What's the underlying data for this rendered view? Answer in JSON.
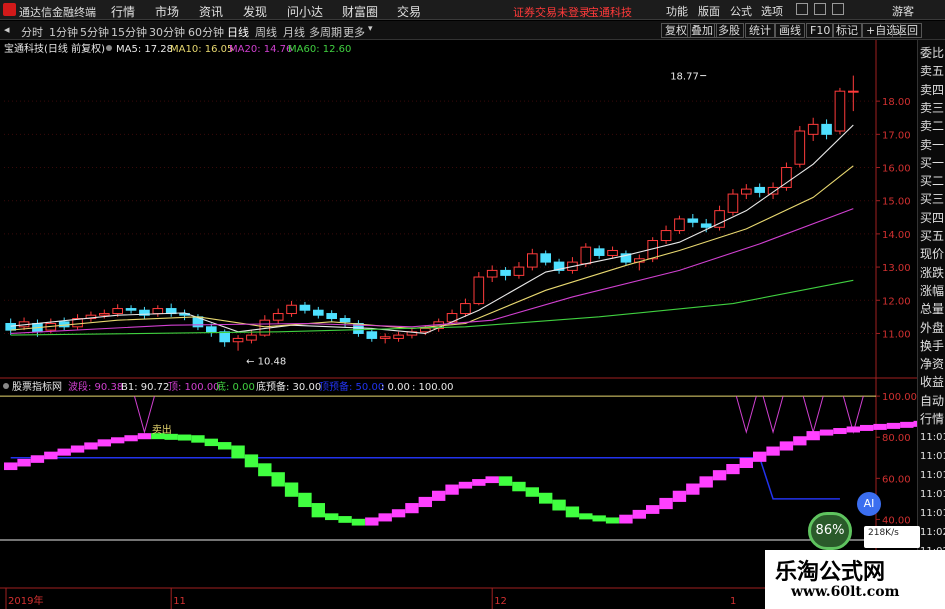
{
  "app": {
    "title": "通达信金融终端",
    "menu": [
      "行情",
      "市场",
      "资讯",
      "发现",
      "问小达",
      "财富圈",
      "交易"
    ],
    "warning": "证券交易未登录",
    "stock_name_top": "宝通科技",
    "right_buttons": [
      "功能",
      "版面",
      "公式",
      "选项"
    ],
    "user_label": "游客"
  },
  "periods": {
    "items": [
      "分时",
      "1分钟",
      "5分钟",
      "15分钟",
      "30分钟",
      "60分钟",
      "日线",
      "周线",
      "月线",
      "多周期",
      "更多"
    ],
    "active": "日线",
    "tools": [
      "复权",
      "叠加",
      "多股",
      "统计",
      "画线",
      "F10",
      "标记",
      "+自选",
      "返回"
    ]
  },
  "main_legend": {
    "title": "宝通科技(日线 前复权)",
    "ma": [
      {
        "label": "MA5: 17.28",
        "color": "#e8e8e8"
      },
      {
        "label": "MA10: 16.05",
        "color": "#e8d870"
      },
      {
        "label": "MA20: 14.76",
        "color": "#d040d0"
      },
      {
        "label": "MA60: 12.60",
        "color": "#40d040"
      }
    ]
  },
  "indicator_legend": {
    "title": "股票指标网",
    "items": [
      {
        "label": "波段: 90.38",
        "color": "#d040d0"
      },
      {
        "label": "B1: 90.72",
        "color": "#e8e8e8"
      },
      {
        "label": "顶: 100.00",
        "color": "#d040d0"
      },
      {
        "label": "底: 0.00",
        "color": "#40d040"
      },
      {
        "label": "底预备: 30.00",
        "color": "#e8e8e8"
      },
      {
        "label": "顶预备: 50.00",
        "color": "#2233ee"
      },
      {
        "label": ": 0.00",
        "color": "#e8e8e8"
      },
      {
        "label": ": 100.00",
        "color": "#e8e8e8"
      }
    ],
    "sell_label": "卖出"
  },
  "right_panel": {
    "items": [
      "委比",
      "卖五",
      "卖四",
      "卖三",
      "卖二",
      "卖一",
      "买一",
      "买二",
      "买三",
      "买四",
      "买五",
      "现价",
      "涨跌",
      "涨幅",
      "总量",
      "外盘",
      "换手",
      "净资",
      "收益",
      "自动",
      "行情"
    ],
    "times": [
      "11:01",
      "11:01",
      "11:01",
      "11:01",
      "11:01",
      "11:02",
      "11:02",
      "11:02",
      "11:02"
    ]
  },
  "badges": {
    "ai": "AI",
    "speed": "86%",
    "net": "218K/s"
  },
  "watermark": {
    "title": "乐淘公式网",
    "url": "www.60lt.com"
  },
  "chart_data": [
    {
      "type": "candlestick",
      "title": "宝通科技(日线 前复权)",
      "yticks": [
        11.0,
        12.0,
        13.0,
        14.0,
        15.0,
        16.0,
        17.0,
        18.0
      ],
      "ylim": [
        10.2,
        19.3
      ],
      "annotations": [
        {
          "text": "18.77",
          "index": 52,
          "value": 18.77,
          "kind": "high"
        },
        {
          "text": "10.48",
          "index": 17,
          "value": 10.48,
          "kind": "low"
        }
      ],
      "candles": [
        {
          "o": 11.3,
          "c": 11.1,
          "h": 11.45,
          "l": 10.95
        },
        {
          "o": 11.2,
          "c": 11.35,
          "h": 11.48,
          "l": 11.1
        },
        {
          "o": 11.3,
          "c": 11.05,
          "h": 11.42,
          "l": 10.9
        },
        {
          "o": 11.1,
          "c": 11.3,
          "h": 11.45,
          "l": 11.0
        },
        {
          "o": 11.35,
          "c": 11.2,
          "h": 11.48,
          "l": 11.1
        },
        {
          "o": 11.2,
          "c": 11.45,
          "h": 11.58,
          "l": 11.12
        },
        {
          "o": 11.45,
          "c": 11.55,
          "h": 11.66,
          "l": 11.35
        },
        {
          "o": 11.55,
          "c": 11.6,
          "h": 11.72,
          "l": 11.45
        },
        {
          "o": 11.6,
          "c": 11.75,
          "h": 11.88,
          "l": 11.5
        },
        {
          "o": 11.75,
          "c": 11.7,
          "h": 11.85,
          "l": 11.6
        },
        {
          "o": 11.7,
          "c": 11.55,
          "h": 11.8,
          "l": 11.45
        },
        {
          "o": 11.6,
          "c": 11.75,
          "h": 11.85,
          "l": 11.5
        },
        {
          "o": 11.75,
          "c": 11.6,
          "h": 11.9,
          "l": 11.5
        },
        {
          "o": 11.6,
          "c": 11.55,
          "h": 11.72,
          "l": 11.4
        },
        {
          "o": 11.5,
          "c": 11.2,
          "h": 11.58,
          "l": 11.1
        },
        {
          "o": 11.2,
          "c": 11.05,
          "h": 11.3,
          "l": 10.9
        },
        {
          "o": 11.05,
          "c": 10.75,
          "h": 11.12,
          "l": 10.6
        },
        {
          "o": 10.75,
          "c": 10.85,
          "h": 10.95,
          "l": 10.48
        },
        {
          "o": 10.8,
          "c": 10.95,
          "h": 11.1,
          "l": 10.7
        },
        {
          "o": 10.95,
          "c": 11.4,
          "h": 11.55,
          "l": 10.9
        },
        {
          "o": 11.4,
          "c": 11.6,
          "h": 11.75,
          "l": 11.3
        },
        {
          "o": 11.6,
          "c": 11.85,
          "h": 11.98,
          "l": 11.5
        },
        {
          "o": 11.85,
          "c": 11.7,
          "h": 11.95,
          "l": 11.6
        },
        {
          "o": 11.7,
          "c": 11.55,
          "h": 11.8,
          "l": 11.45
        },
        {
          "o": 11.6,
          "c": 11.45,
          "h": 11.7,
          "l": 11.35
        },
        {
          "o": 11.45,
          "c": 11.35,
          "h": 11.55,
          "l": 11.2
        },
        {
          "o": 11.3,
          "c": 11.0,
          "h": 11.4,
          "l": 10.9
        },
        {
          "o": 11.05,
          "c": 10.85,
          "h": 11.15,
          "l": 10.75
        },
        {
          "o": 10.85,
          "c": 10.9,
          "h": 11.0,
          "l": 10.7
        },
        {
          "o": 10.85,
          "c": 10.95,
          "h": 11.05,
          "l": 10.75
        },
        {
          "o": 10.95,
          "c": 11.05,
          "h": 11.15,
          "l": 10.85
        },
        {
          "o": 11.05,
          "c": 11.15,
          "h": 11.25,
          "l": 10.95
        },
        {
          "o": 11.15,
          "c": 11.35,
          "h": 11.45,
          "l": 11.05
        },
        {
          "o": 11.35,
          "c": 11.6,
          "h": 11.72,
          "l": 11.25
        },
        {
          "o": 11.6,
          "c": 11.9,
          "h": 12.05,
          "l": 11.5
        },
        {
          "o": 11.9,
          "c": 12.7,
          "h": 12.85,
          "l": 11.85
        },
        {
          "o": 12.7,
          "c": 12.9,
          "h": 13.05,
          "l": 12.55
        },
        {
          "o": 12.9,
          "c": 12.75,
          "h": 13.0,
          "l": 12.6
        },
        {
          "o": 12.75,
          "c": 13.0,
          "h": 13.15,
          "l": 12.65
        },
        {
          "o": 13.0,
          "c": 13.4,
          "h": 13.55,
          "l": 12.9
        },
        {
          "o": 13.4,
          "c": 13.15,
          "h": 13.5,
          "l": 13.05
        },
        {
          "o": 13.15,
          "c": 12.9,
          "h": 13.25,
          "l": 12.8
        },
        {
          "o": 12.9,
          "c": 13.15,
          "h": 13.3,
          "l": 12.8
        },
        {
          "o": 13.1,
          "c": 13.6,
          "h": 13.72,
          "l": 13.0
        },
        {
          "o": 13.55,
          "c": 13.35,
          "h": 13.65,
          "l": 13.25
        },
        {
          "o": 13.35,
          "c": 13.5,
          "h": 13.62,
          "l": 13.25
        },
        {
          "o": 13.4,
          "c": 13.15,
          "h": 13.5,
          "l": 13.05
        },
        {
          "o": 13.15,
          "c": 13.25,
          "h": 13.38,
          "l": 12.9
        },
        {
          "o": 13.25,
          "c": 13.8,
          "h": 13.9,
          "l": 13.15
        },
        {
          "o": 13.8,
          "c": 14.1,
          "h": 14.25,
          "l": 13.7
        },
        {
          "o": 14.1,
          "c": 14.45,
          "h": 14.55,
          "l": 14.0
        },
        {
          "o": 14.45,
          "c": 14.35,
          "h": 14.6,
          "l": 14.2
        },
        {
          "o": 14.3,
          "c": 14.2,
          "h": 14.45,
          "l": 14.05
        },
        {
          "o": 14.2,
          "c": 14.7,
          "h": 14.85,
          "l": 14.1
        },
        {
          "o": 14.65,
          "c": 15.2,
          "h": 15.35,
          "l": 14.55
        },
        {
          "o": 15.2,
          "c": 15.35,
          "h": 15.5,
          "l": 15.05
        },
        {
          "o": 15.4,
          "c": 15.25,
          "h": 15.52,
          "l": 15.1
        },
        {
          "o": 15.2,
          "c": 15.4,
          "h": 15.55,
          "l": 15.05
        },
        {
          "o": 15.4,
          "c": 16.0,
          "h": 16.15,
          "l": 15.3
        },
        {
          "o": 16.1,
          "c": 17.1,
          "h": 17.25,
          "l": 16.0
        },
        {
          "o": 17.0,
          "c": 17.3,
          "h": 17.5,
          "l": 16.8
        },
        {
          "o": 17.3,
          "c": 17.0,
          "h": 17.45,
          "l": 16.85
        },
        {
          "o": 17.1,
          "c": 18.3,
          "h": 18.4,
          "l": 17.0
        },
        {
          "o": 18.3,
          "c": 18.3,
          "h": 18.77,
          "l": 17.7
        }
      ],
      "ma": [
        {
          "name": "MA5",
          "color": "#e8e8e8",
          "values": [
            [
              0,
              11.22
            ],
            [
              8,
              11.55
            ],
            [
              13,
              11.62
            ],
            [
              17,
              11.05
            ],
            [
              21,
              11.25
            ],
            [
              27,
              11.15
            ],
            [
              31,
              11.0
            ],
            [
              35,
              11.7
            ],
            [
              40,
              12.85
            ],
            [
              46,
              13.35
            ],
            [
              50,
              13.75
            ],
            [
              55,
              14.7
            ],
            [
              60,
              16.1
            ],
            [
              63,
              17.28
            ]
          ]
        },
        {
          "name": "MA10",
          "color": "#e8d870",
          "values": [
            [
              0,
              11.1
            ],
            [
              8,
              11.4
            ],
            [
              14,
              11.5
            ],
            [
              19,
              11.2
            ],
            [
              24,
              11.35
            ],
            [
              30,
              11.15
            ],
            [
              34,
              11.3
            ],
            [
              40,
              12.3
            ],
            [
              46,
              13.05
            ],
            [
              50,
              13.5
            ],
            [
              55,
              14.15
            ],
            [
              60,
              15.1
            ],
            [
              63,
              16.05
            ]
          ]
        },
        {
          "name": "MA20",
          "color": "#d040d0",
          "values": [
            [
              0,
              11.0
            ],
            [
              12,
              11.25
            ],
            [
              22,
              11.3
            ],
            [
              30,
              11.2
            ],
            [
              36,
              11.4
            ],
            [
              42,
              12.1
            ],
            [
              50,
              12.9
            ],
            [
              56,
              13.7
            ],
            [
              63,
              14.76
            ]
          ]
        },
        {
          "name": "MA60",
          "color": "#40d040",
          "values": [
            [
              0,
              10.95
            ],
            [
              20,
              11.05
            ],
            [
              34,
              11.2
            ],
            [
              44,
              11.5
            ],
            [
              54,
              11.9
            ],
            [
              63,
              12.6
            ]
          ]
        }
      ]
    },
    {
      "type": "indicator",
      "title": "股票指标网",
      "yticks": [
        40.0,
        60.0,
        80.0,
        100.0
      ],
      "ylim": [
        30,
        102
      ],
      "levels": [
        {
          "name": "底预备",
          "value": 30.0,
          "color": "#e8e8e8"
        },
        {
          "name": "顶",
          "value": 100.0,
          "color": "#e8d870"
        }
      ],
      "ribbon": [
        [
          0,
          65
        ],
        [
          4,
          72
        ],
        [
          8,
          78
        ],
        [
          11,
          81
        ],
        [
          14,
          80
        ],
        [
          17,
          75
        ],
        [
          20,
          62
        ],
        [
          24,
          42
        ],
        [
          27,
          38
        ],
        [
          30,
          44
        ],
        [
          34,
          56
        ],
        [
          37,
          60
        ],
        [
          40,
          52
        ],
        [
          43,
          42
        ],
        [
          46,
          39
        ],
        [
          49,
          46
        ],
        [
          53,
          60
        ],
        [
          57,
          72
        ],
        [
          61,
          82
        ],
        [
          65,
          85
        ],
        [
          69,
          87
        ],
        [
          73,
          88
        ],
        [
          77,
          90
        ],
        [
          81,
          90
        ],
        [
          85,
          90
        ],
        [
          88,
          89
        ]
      ],
      "step_line": [
        [
          0,
          70
        ],
        [
          56,
          70
        ],
        [
          57,
          50
        ],
        [
          62,
          50
        ]
      ],
      "v_marks": [
        10,
        55,
        57,
        60,
        63
      ]
    }
  ],
  "date_axis": {
    "labels": [
      "2019年",
      "11",
      "12"
    ],
    "positions": [
      0,
      12,
      36
    ],
    "extra_right": "1"
  }
}
